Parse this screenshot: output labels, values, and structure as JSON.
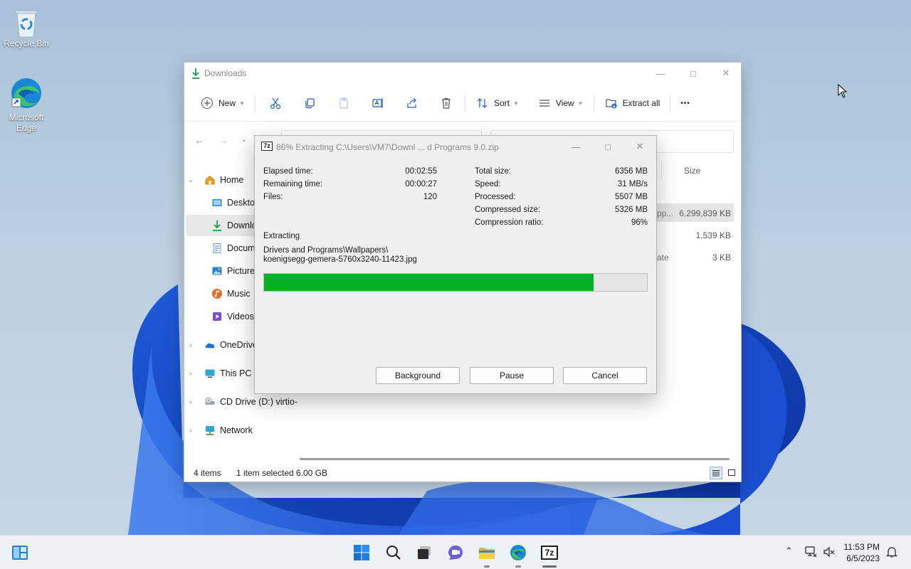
{
  "desktop": {
    "icons": [
      {
        "label": "Recycle Bin",
        "icon": "recycle-bin-icon"
      },
      {
        "label": "Microsoft\nEdge",
        "label_line1": "Microsoft",
        "label_line2": "Edge",
        "icon": "edge-icon"
      }
    ]
  },
  "explorer": {
    "title": "Downloads",
    "toolbar": {
      "new_label": "New",
      "sort_label": "Sort",
      "view_label": "View",
      "extract_label": "Extract all",
      "more_label": "•••"
    },
    "sidebar": {
      "items": [
        {
          "label": "Home",
          "icon": "home-icon"
        },
        {
          "label": "Desktop",
          "icon": "desktop-folder-icon"
        },
        {
          "label": "Downloads",
          "icon": "downloads-icon"
        },
        {
          "label": "Documents",
          "icon": "documents-icon"
        },
        {
          "label": "Pictures",
          "icon": "pictures-icon"
        },
        {
          "label": "Music",
          "icon": "music-icon"
        },
        {
          "label": "Videos",
          "icon": "videos-icon"
        },
        {
          "label": "OneDrive",
          "icon": "onedrive-icon"
        },
        {
          "label": "This PC",
          "icon": "this-pc-icon"
        },
        {
          "label": "CD Drive (D:) virtio-",
          "icon": "cd-drive-icon"
        },
        {
          "label": "Network",
          "icon": "network-icon"
        }
      ]
    },
    "columns": {
      "size": "Size"
    },
    "files": [
      {
        "name_fragment": "pp...",
        "size": "6,299,839 KB"
      },
      {
        "name_fragment": "",
        "size": "1,539 KB"
      },
      {
        "name_fragment": "ate",
        "size": "3 KB"
      }
    ],
    "status": {
      "items": "4 items",
      "selected": "1 item selected",
      "size": "6.00 GB"
    }
  },
  "zip_dialog": {
    "title": "86% Extracting C:\\Users\\VM7\\Downl ... d Programs 9.0.zip",
    "logo": "7z",
    "left_stats": [
      {
        "label": "Elapsed time:",
        "value": "00:02:55"
      },
      {
        "label": "Remaining time:",
        "value": "00:00:27"
      },
      {
        "label": "Files:",
        "value": "120"
      }
    ],
    "right_stats": [
      {
        "label": "Total size:",
        "value": "6356 MB"
      },
      {
        "label": "Speed:",
        "value": "31 MB/s"
      },
      {
        "label": "Processed:",
        "value": "5507 MB"
      },
      {
        "label": "Compressed size:",
        "value": "5326 MB"
      },
      {
        "label": "Compression ratio:",
        "value": "96%"
      }
    ],
    "operation": "Extracting",
    "current_path": "Drivers and Programs\\Wallpapers\\",
    "current_file": "koenigsegg-gemera-5760x3240-11423.jpg",
    "progress_percent": 86,
    "progress_color": "#06b025",
    "buttons": {
      "background": "Background",
      "pause": "Pause",
      "cancel": "Cancel"
    }
  },
  "taskbar": {
    "apps": [
      "widgets-icon",
      "start-icon",
      "search-icon",
      "task-view-icon",
      "teams-chat-icon",
      "file-explorer-icon",
      "edge-icon",
      "7zip-icon"
    ],
    "seven_zip_label": "7z",
    "clock": {
      "time": "11:53 PM",
      "date": "6/5/2023"
    }
  }
}
